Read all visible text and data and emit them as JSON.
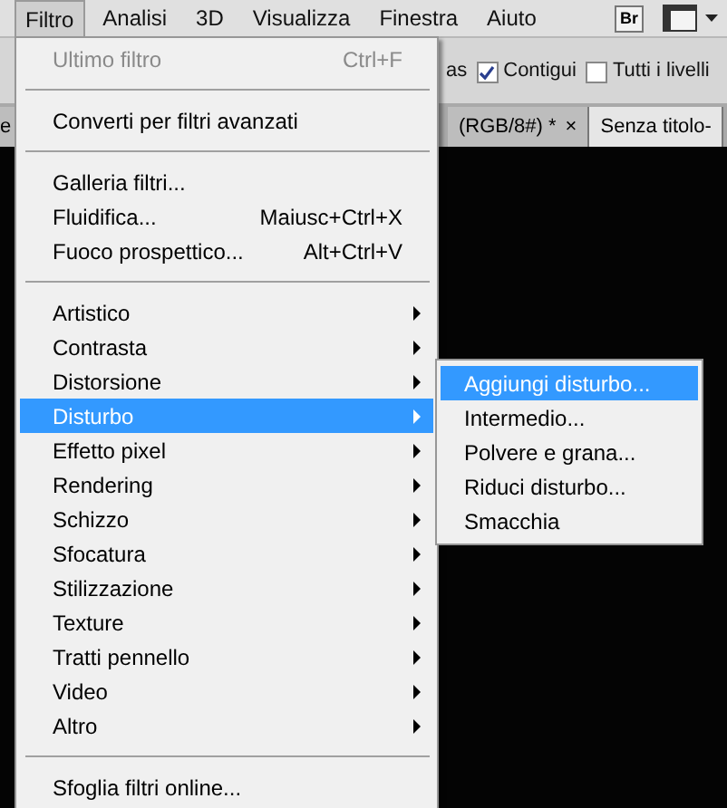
{
  "menubar": [
    {
      "label": "Filtro",
      "selected": true
    },
    {
      "label": "Analisi",
      "selected": false
    },
    {
      "label": "3D",
      "selected": false
    },
    {
      "label": "Visualizza",
      "selected": false
    },
    {
      "label": "Finestra",
      "selected": false
    },
    {
      "label": "Aiuto",
      "selected": false
    }
  ],
  "bridge_button": "Br",
  "options_bar": {
    "cut_label": "as",
    "options": [
      {
        "label": "Contigui",
        "checked": true
      },
      {
        "label": "Tutti i livelli",
        "checked": false
      }
    ]
  },
  "document_tabs": [
    {
      "label": "e",
      "selected": false
    },
    {
      "label": "(RGB/8#) *",
      "selected": false,
      "close": "×"
    },
    {
      "label": "Senza titolo-",
      "selected": true
    }
  ],
  "menu": [
    {
      "kind": "item",
      "label": "Ultimo filtro",
      "shortcut": "Ctrl+F",
      "disabled": true,
      "submenu": false,
      "selected": false
    },
    {
      "kind": "separator"
    },
    {
      "kind": "item",
      "label": "Converti per filtri avanzati",
      "disabled": false,
      "submenu": false,
      "selected": false
    },
    {
      "kind": "separator"
    },
    {
      "kind": "item",
      "label": "Galleria filtri...",
      "disabled": false,
      "submenu": false,
      "selected": false
    },
    {
      "kind": "item",
      "label": "Fluidifica...",
      "shortcut": "Maiusc+Ctrl+X",
      "disabled": false,
      "submenu": false,
      "selected": false
    },
    {
      "kind": "item",
      "label": "Fuoco prospettico...",
      "shortcut": "Alt+Ctrl+V",
      "disabled": false,
      "submenu": false,
      "selected": false
    },
    {
      "kind": "separator"
    },
    {
      "kind": "item",
      "label": "Artistico",
      "disabled": false,
      "submenu": true,
      "selected": false
    },
    {
      "kind": "item",
      "label": "Contrasta",
      "disabled": false,
      "submenu": true,
      "selected": false
    },
    {
      "kind": "item",
      "label": "Distorsione",
      "disabled": false,
      "submenu": true,
      "selected": false
    },
    {
      "kind": "item",
      "label": "Disturbo",
      "disabled": false,
      "submenu": true,
      "selected": true
    },
    {
      "kind": "item",
      "label": "Effetto pixel",
      "disabled": false,
      "submenu": true,
      "selected": false
    },
    {
      "kind": "item",
      "label": "Rendering",
      "disabled": false,
      "submenu": true,
      "selected": false
    },
    {
      "kind": "item",
      "label": "Schizzo",
      "disabled": false,
      "submenu": true,
      "selected": false
    },
    {
      "kind": "item",
      "label": "Sfocatura",
      "disabled": false,
      "submenu": true,
      "selected": false
    },
    {
      "kind": "item",
      "label": "Stilizzazione",
      "disabled": false,
      "submenu": true,
      "selected": false
    },
    {
      "kind": "item",
      "label": "Texture",
      "disabled": false,
      "submenu": true,
      "selected": false
    },
    {
      "kind": "item",
      "label": "Tratti pennello",
      "disabled": false,
      "submenu": true,
      "selected": false
    },
    {
      "kind": "item",
      "label": "Video",
      "disabled": false,
      "submenu": true,
      "selected": false
    },
    {
      "kind": "item",
      "label": "Altro",
      "disabled": false,
      "submenu": true,
      "selected": false
    },
    {
      "kind": "separator"
    },
    {
      "kind": "item",
      "label": "Sfoglia filtri online...",
      "disabled": false,
      "submenu": false,
      "selected": false
    }
  ],
  "submenu": [
    {
      "label": "Aggiungi disturbo...",
      "selected": true
    },
    {
      "label": "Intermedio...",
      "selected": false
    },
    {
      "label": "Polvere e grana...",
      "selected": false
    },
    {
      "label": "Riduci disturbo...",
      "selected": false
    },
    {
      "label": "Smacchia",
      "selected": false
    }
  ]
}
